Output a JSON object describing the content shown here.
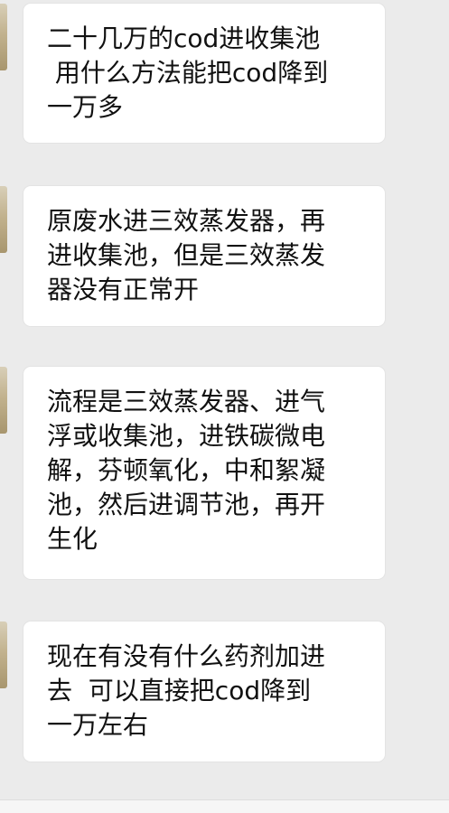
{
  "messages": [
    {
      "text": "二十几万的cod进收集池\n 用什么方法能把cod降到\n一万多"
    },
    {
      "text": "原废水进三效蒸发器，再\n进收集池，但是三效蒸发\n器没有正常开"
    },
    {
      "text": "流程是三效蒸发器、进气\n浮或收集池，进铁碳微电\n解，芬顿氧化，中和絮凝\n池，然后进调节池，再开\n生化"
    },
    {
      "text": "现在有没有什么药剂加进\n去  可以直接把cod降到\n一万左右"
    }
  ]
}
